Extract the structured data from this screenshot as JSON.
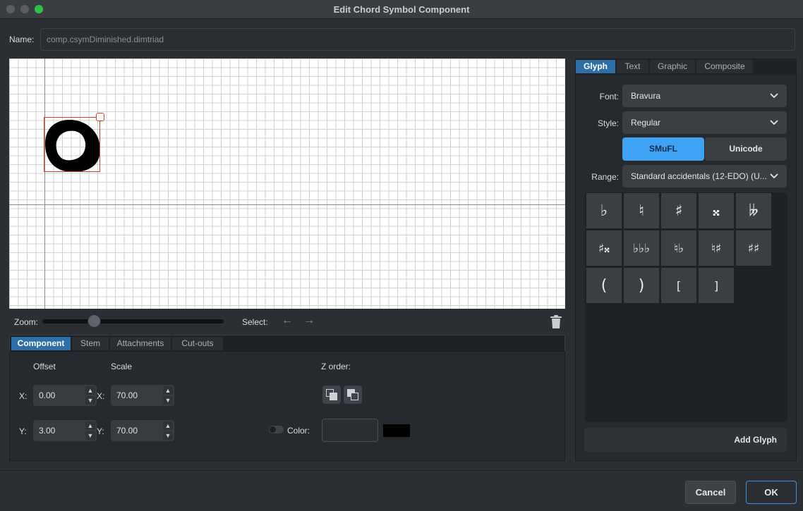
{
  "window": {
    "title": "Edit Chord Symbol Component"
  },
  "name": {
    "label": "Name:",
    "value": "comp.csymDiminished.dimtriad"
  },
  "zoom": {
    "label": "Zoom:",
    "level": 0.27
  },
  "select": {
    "label": "Select:",
    "prev": "←",
    "next": "→"
  },
  "component_tabs": [
    "Component",
    "Stem",
    "Attachments",
    "Cut-outs"
  ],
  "component": {
    "offset_label": "Offset",
    "scale_label": "Scale",
    "z_order_label": "Z order:",
    "x_label": "X:",
    "y_label": "Y:",
    "offset_x": "0.00",
    "offset_y": "3.00",
    "scale_x": "70.00",
    "scale_y": "70.00",
    "color_label": "Color:",
    "color_value": "#000000"
  },
  "glyph_tabs": [
    "Glyph",
    "Text",
    "Graphic",
    "Composite"
  ],
  "glyph": {
    "font_label": "Font:",
    "font_value": "Bravura",
    "style_label": "Style:",
    "style_value": "Regular",
    "smufl_label": "SMuFL",
    "unicode_label": "Unicode",
    "range_label": "Range:",
    "range_value": "Standard accidentals (12-EDO) (U...",
    "glyphs": [
      "♭",
      "♮",
      "♯",
      "𝄪",
      "𝄫",
      "♯𝄪",
      "♭♭♭",
      "♮♭",
      "♮♯",
      "♯♯",
      "(",
      ")",
      "[",
      "]"
    ],
    "add_label": "Add Glyph"
  },
  "footer": {
    "cancel": "Cancel",
    "ok": "OK"
  },
  "colors": {
    "accent": "#3d8fd8",
    "selection": "#d9411e",
    "active_tab": "#2e6fa8",
    "smufl_active": "#3fa3f5"
  }
}
